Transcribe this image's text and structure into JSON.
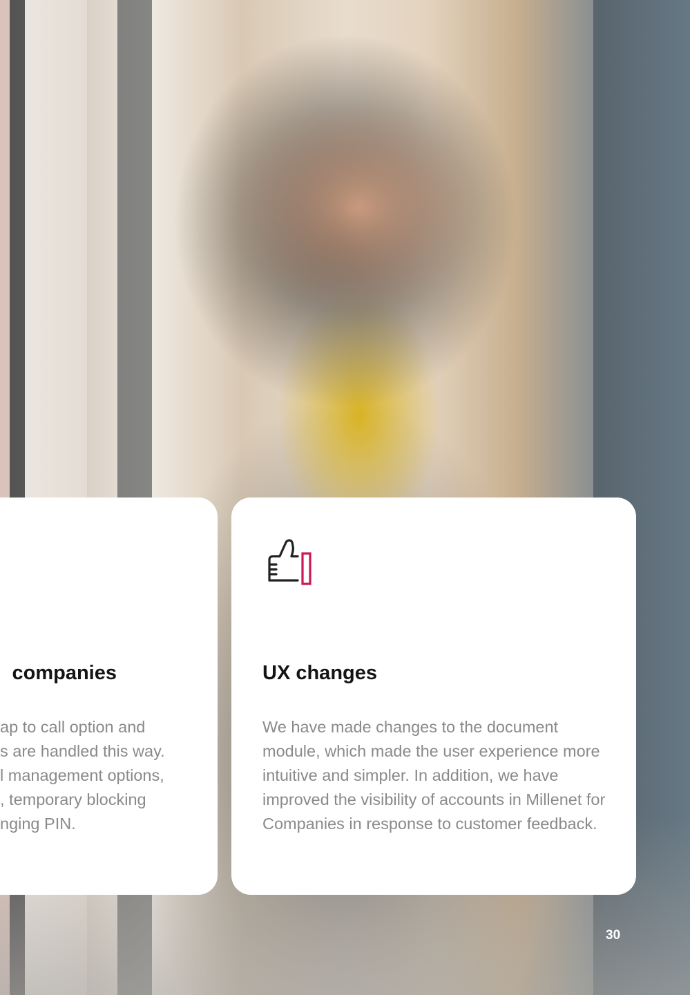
{
  "left_card": {
    "title": "companies",
    "lines": [
      "ap to call option and",
      "s are handled this way.",
      "l management options,",
      ", temporary blocking",
      "nging PIN."
    ]
  },
  "right_card": {
    "icon": "thumbs-up-icon",
    "title": "UX changes",
    "body": "We have made changes to the document module, which made the user experience more intuitive and simpler. In addition, we have improved the visibility of accounts in Millenet for Companies in response to customer feedback."
  },
  "page_number": "30",
  "colors": {
    "accent": "#c8185a",
    "icon_stroke": "#222222",
    "body_text": "#8a8a8a",
    "title_text": "#141414"
  }
}
